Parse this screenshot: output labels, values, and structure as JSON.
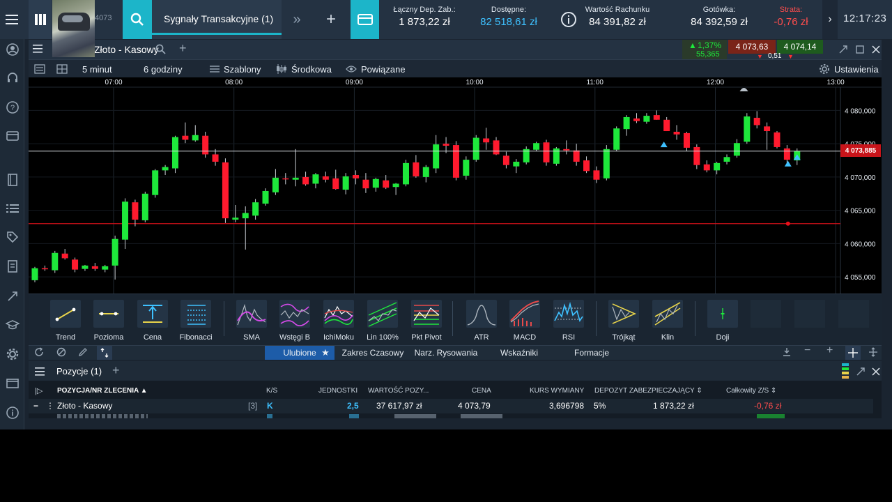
{
  "topbar": {
    "account_number_fragment": "4073",
    "tab_title": "Sygnały Transakcyjne (1)",
    "metrics": [
      {
        "label": "Łączny Dep. Zab.:",
        "value": "1 873,22 zł",
        "color": "#ffffff"
      },
      {
        "label": "Dostępne:",
        "value": "82 518,61 zł",
        "color": "#3ec1ff"
      },
      {
        "label": "Wartość Rachunku",
        "value": "84 391,82 zł",
        "color": "#ffffff"
      },
      {
        "label": "Gotówka:",
        "value": "84 392,59 zł",
        "color": "#ffffff"
      },
      {
        "label": "Strata:",
        "value": "-0,76 zł",
        "color": "#ff4d4d"
      }
    ],
    "clock": "12:17:23"
  },
  "chart": {
    "instrument": "Złoto - Kasowy",
    "change_pct": "1,37%",
    "change_pts": "55,365",
    "bid": "4 073,63",
    "ask": "4 074,14",
    "spread": "0,51",
    "interval": "5 minut",
    "range": "6 godziny",
    "templates": "Szablony",
    "price_type": "Środkowa",
    "linked": "Powiązane",
    "settings": "Ustawienia",
    "current_price_label": "4 073,885"
  },
  "chart_data": {
    "type": "candlestick",
    "x_ticks": [
      "07:00",
      "08:00",
      "09:00",
      "10:00",
      "11:00",
      "12:00",
      "13:00"
    ],
    "y_ticks": [
      "4 080,000",
      "4 075,000",
      "4 070,000",
      "4 065,000",
      "4 060,000",
      "4 055,000"
    ],
    "ylim": [
      4052.5,
      4083.5
    ],
    "start_time": "06:30",
    "interval": "5 minut",
    "current_price": 4073.885,
    "order_level": 4063.0,
    "candles": [
      [
        4054.5,
        4056.5,
        4054.2,
        4056.3
      ],
      [
        4056.3,
        4056.7,
        4055.9,
        4056.2
      ],
      [
        4056.0,
        4058.9,
        4055.6,
        4058.6
      ],
      [
        4058.5,
        4059.2,
        4057.6,
        4057.8
      ],
      [
        4057.6,
        4057.9,
        4055.7,
        4056.1
      ],
      [
        4056.2,
        4056.8,
        4055.9,
        4056.7
      ],
      [
        4056.6,
        4057.1,
        4055.9,
        4056.2
      ],
      [
        4056.1,
        4056.8,
        4055.7,
        4056.6
      ],
      [
        4056.7,
        4061.2,
        4054.6,
        4060.7
      ],
      [
        4060.6,
        4066.8,
        4059.2,
        4066.3
      ],
      [
        4066.2,
        4066.6,
        4062.6,
        4063.6
      ],
      [
        4063.5,
        4067.8,
        4063.2,
        4067.5
      ],
      [
        4067.3,
        4071.2,
        4066.9,
        4071.0
      ],
      [
        4071.0,
        4071.8,
        4070.3,
        4071.5
      ],
      [
        4071.3,
        4076.2,
        4070.6,
        4076.0
      ],
      [
        4076.2,
        4078.2,
        4075.1,
        4075.6
      ],
      [
        4075.5,
        4077.8,
        4075.3,
        4076.3
      ],
      [
        4076.2,
        4076.8,
        4072.9,
        4073.4
      ],
      [
        4073.4,
        4074.2,
        4071.7,
        4072.3
      ],
      [
        4072.2,
        4072.8,
        4063.1,
        4063.8
      ],
      [
        4063.6,
        4065.8,
        4063.2,
        4063.9
      ],
      [
        4063.8,
        4065.6,
        4059.1,
        4064.6
      ],
      [
        4064.2,
        4066.7,
        4063.6,
        4066.2
      ],
      [
        4066.0,
        4068.3,
        4065.7,
        4067.9
      ],
      [
        4067.7,
        4071.2,
        4067.3,
        4069.9
      ],
      [
        4069.8,
        4070.6,
        4068.9,
        4069.7
      ],
      [
        4069.6,
        4074.2,
        4068.6,
        4069.9
      ],
      [
        4070.0,
        4070.8,
        4068.7,
        4068.9
      ],
      [
        4069.0,
        4070.6,
        4068.3,
        4070.4
      ],
      [
        4070.1,
        4070.8,
        4069.2,
        4069.6
      ],
      [
        4069.8,
        4071.1,
        4068.1,
        4068.2
      ],
      [
        4068.1,
        4070.6,
        4067.4,
        4070.1
      ],
      [
        4070.3,
        4071.0,
        4068.9,
        4069.8
      ],
      [
        4069.6,
        4070.6,
        4067.6,
        4068.3
      ],
      [
        4068.4,
        4069.9,
        4067.8,
        4069.7
      ],
      [
        4069.5,
        4070.3,
        4068.2,
        4068.4
      ],
      [
        4068.5,
        4069.1,
        4067.3,
        4069.0
      ],
      [
        4068.9,
        4072.6,
        4068.6,
        4072.1
      ],
      [
        4072.2,
        4073.3,
        4069.9,
        4070.1
      ],
      [
        4070.0,
        4071.8,
        4069.2,
        4071.5
      ],
      [
        4071.3,
        4076.3,
        4070.6,
        4074.9
      ],
      [
        4075.0,
        4076.0,
        4073.6,
        4074.7
      ],
      [
        4074.8,
        4075.4,
        4069.5,
        4069.9
      ],
      [
        4070.2,
        4073.1,
        4069.6,
        4072.6
      ],
      [
        4072.6,
        4076.3,
        4072.3,
        4075.9
      ],
      [
        4075.8,
        4077.4,
        4074.1,
        4075.2
      ],
      [
        4075.5,
        4076.0,
        4073.3,
        4073.4
      ],
      [
        4073.2,
        4073.8,
        4071.3,
        4071.8
      ],
      [
        4071.6,
        4072.7,
        4070.6,
        4072.3
      ],
      [
        4072.2,
        4074.6,
        4071.9,
        4074.2
      ],
      [
        4074.1,
        4075.3,
        4073.9,
        4075.1
      ],
      [
        4075.2,
        4075.6,
        4071.7,
        4072.2
      ],
      [
        4072.0,
        4074.5,
        4071.7,
        4074.3
      ],
      [
        4074.2,
        4075.5,
        4073.4,
        4074.0
      ],
      [
        4074.0,
        4075.0,
        4071.7,
        4072.3
      ],
      [
        4072.5,
        4073.1,
        4070.6,
        4070.9
      ],
      [
        4071.0,
        4071.6,
        4069.1,
        4069.6
      ],
      [
        4069.8,
        4074.8,
        4069.5,
        4074.2
      ],
      [
        4074.1,
        4077.6,
        4073.9,
        4077.3
      ],
      [
        4077.2,
        4079.3,
        4076.2,
        4079.0
      ],
      [
        4078.8,
        4079.6,
        4078.1,
        4078.4
      ],
      [
        4078.3,
        4079.6,
        4078.0,
        4079.2
      ],
      [
        4079.3,
        4080.0,
        4078.6,
        4078.6
      ],
      [
        4078.6,
        4079.0,
        4076.9,
        4076.9
      ],
      [
        4076.8,
        4077.8,
        4075.6,
        4076.4
      ],
      [
        4076.6,
        4076.8,
        4073.9,
        4074.4
      ],
      [
        4074.5,
        4074.9,
        4071.2,
        4071.8
      ],
      [
        4071.9,
        4072.5,
        4070.7,
        4071.0
      ],
      [
        4071.0,
        4072.3,
        4070.4,
        4072.1
      ],
      [
        4072.3,
        4073.4,
        4071.9,
        4073.0
      ],
      [
        4073.2,
        4075.7,
        4072.9,
        4075.1
      ],
      [
        4075.3,
        4079.6,
        4075.0,
        4079.1
      ],
      [
        4078.9,
        4079.9,
        4077.3,
        4077.8
      ],
      [
        4077.6,
        4078.2,
        4074.1,
        4076.9
      ],
      [
        4076.7,
        4076.9,
        4074.3,
        4074.5
      ],
      [
        4074.3,
        4074.8,
        4072.1,
        4072.6
      ],
      [
        4072.5,
        4074.3,
        4071.8,
        4073.9
      ]
    ]
  },
  "drawing_tools": [
    "Trend",
    "Pozioma",
    "Cena",
    "Fibonacci",
    "SMA",
    "Wstęgi B",
    "IchiMoku",
    "Lin 100%",
    "Pkt Pivot",
    "ATR",
    "MACD",
    "RSI",
    "Trójkąt",
    "Klin",
    "Doji"
  ],
  "bottom_tabs": {
    "favorites": "Ulubione",
    "time_range": "Zakres Czasowy",
    "drawing": "Narz. Rysowania",
    "indicators": "Wskaźniki",
    "patterns": "Formacje"
  },
  "positions": {
    "title": "Pozycje (1)",
    "columns": [
      "POZYCJA/NR ZLECENIA",
      "K/S",
      "JEDNOSTKI",
      "WARTOŚĆ POZY...",
      "CENA",
      "KURS WYMIANY",
      "DEPOZYT ZABEZPIECZAJĄCY",
      "Całkowity Z/S"
    ],
    "row": {
      "name": "Złoto - Kasowy",
      "count": "[3]",
      "side": "K",
      "units": "2,5",
      "value": "37 617,97 zł",
      "price": "4 073,79",
      "fx": "3,696798",
      "margin_pct": "5%",
      "margin": "1 873,22 zł",
      "pl": "-0,76 zł"
    }
  },
  "colors": {
    "up": "#1ee83b",
    "down": "#ff1a2e",
    "accent": "#1cb5c9",
    "loss": "#ff4d4d",
    "available": "#3ec1ff"
  }
}
